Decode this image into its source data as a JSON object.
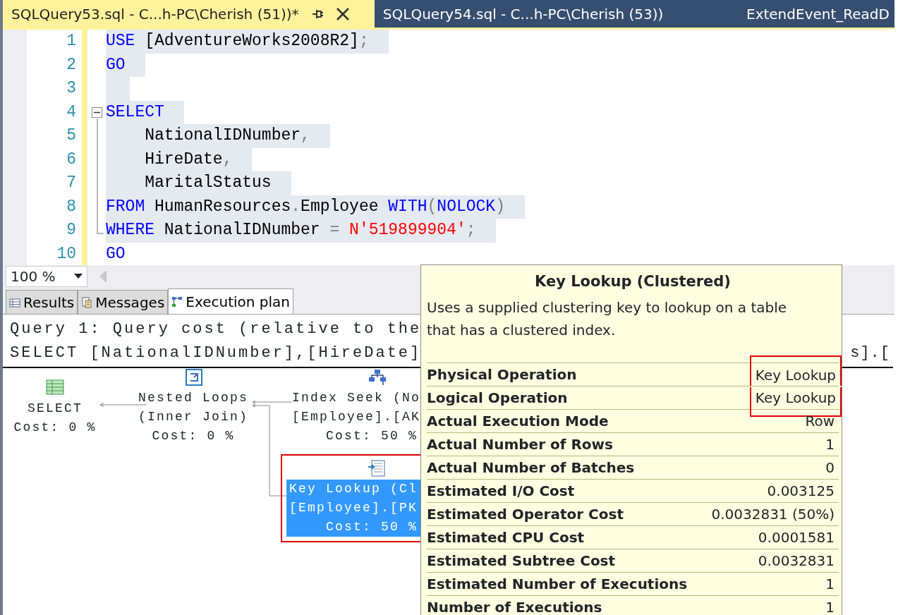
{
  "tabs": [
    {
      "title": "SQLQuery53.sql - C...h-PC\\Cherish (51))*",
      "selected": true
    },
    {
      "title": "SQLQuery54.sql - C...h-PC\\Cherish (53))",
      "selected": false
    },
    {
      "title": "ExtendEvent_ReadD",
      "selected": false
    }
  ],
  "editor": {
    "lines": [
      {
        "number": "1",
        "selected": true,
        "tokens": [
          {
            "kind": "keyword",
            "text": "USE"
          },
          {
            "kind": "plain",
            "text": " [AdventureWorks2008R2]"
          },
          {
            "kind": "punct",
            "text": ";"
          }
        ]
      },
      {
        "number": "2",
        "selected": true,
        "tokens": [
          {
            "kind": "keyword",
            "text": "GO"
          }
        ]
      },
      {
        "number": "3",
        "selected": true
      },
      {
        "number": "4",
        "selected": true,
        "expanded": true,
        "tokens": [
          {
            "kind": "keyword",
            "text": "SELECT"
          }
        ],
        "children": [
          {
            "number": "5",
            "selected": true,
            "tokens": [
              {
                "kind": "plain",
                "text": "    NationalIDNumber"
              },
              {
                "kind": "punct",
                "text": ","
              }
            ]
          },
          {
            "number": "6",
            "selected": true,
            "tokens": [
              {
                "kind": "plain",
                "text": "    HireDate"
              },
              {
                "kind": "punct",
                "text": ","
              }
            ]
          },
          {
            "number": "7",
            "selected": true,
            "tokens": [
              {
                "kind": "plain",
                "text": "    MaritalStatus"
              }
            ]
          },
          {
            "number": "8",
            "selected": true,
            "tokens": [
              {
                "kind": "keyword",
                "text": "FROM"
              },
              {
                "kind": "plain",
                "text": " HumanResources"
              },
              {
                "kind": "punct",
                "text": "."
              },
              {
                "kind": "plain",
                "text": "Employee "
              },
              {
                "kind": "keyword",
                "text": "WITH"
              },
              {
                "kind": "punct",
                "text": "("
              },
              {
                "kind": "keyword",
                "text": "NOLOCK"
              },
              {
                "kind": "punct",
                "text": ")"
              }
            ]
          },
          {
            "number": "9",
            "selected": true,
            "tokens": [
              {
                "kind": "keyword",
                "text": "WHERE"
              },
              {
                "kind": "plain",
                "text": " NationalIDNumber "
              },
              {
                "kind": "punct",
                "text": "= "
              },
              {
                "kind": "string",
                "text": "N'519899904'"
              },
              {
                "kind": "punct",
                "text": ";"
              }
            ]
          }
        ]
      },
      {
        "number": "10",
        "selected": false,
        "tokens": [
          {
            "kind": "keyword",
            "text": "GO"
          }
        ]
      }
    ]
  },
  "zoom": {
    "value": "100 %"
  },
  "result_tabs": [
    {
      "label": "Results",
      "kind": "grid",
      "selected": false
    },
    {
      "label": "Messages",
      "kind": "messages",
      "selected": false
    },
    {
      "label": "Execution plan",
      "kind": "plan",
      "selected": true
    }
  ],
  "plan": {
    "header_lines": [
      {
        "text": "Query 1: Query cost (relative to the"
      },
      {
        "text": "SELECT [NationalIDNumber],[HireDate]",
        "continuation": "s].["
      }
    ],
    "nodes": [
      {
        "kind": "select",
        "lines": [
          "SELECT",
          "Cost: 0 %"
        ],
        "selected": false,
        "highlighted": false
      },
      {
        "kind": "nested_loops",
        "lines": [
          "Nested Loops",
          "(Inner Join)",
          "Cost: 0 %"
        ],
        "selected": false,
        "highlighted": false
      },
      {
        "kind": "index_seek",
        "lines": [
          "Index Seek (No",
          "[Employee].[AK",
          "Cost: 50 %"
        ],
        "selected": false,
        "highlighted": false
      },
      {
        "kind": "key_lookup",
        "lines": [
          "Key Lookup (Cl",
          "[Employee].[PK",
          "Cost: 50 %"
        ],
        "selected": true,
        "highlighted": true
      }
    ]
  },
  "tooltip": {
    "title": "Key Lookup (Clustered)",
    "description": "Uses a supplied clustering key to lookup on a table that has a clustered index.",
    "properties": [
      {
        "name": "Physical Operation",
        "value": "Key Lookup",
        "highlighted": true
      },
      {
        "name": "Logical Operation",
        "value": "Key Lookup",
        "highlighted": true
      },
      {
        "name": "Actual Execution Mode",
        "value": "Row",
        "highlighted": false
      },
      {
        "name": "Actual Number of Rows",
        "value": "1",
        "highlighted": false
      },
      {
        "name": "Actual Number of Batches",
        "value": "0",
        "highlighted": false
      },
      {
        "name": "Estimated I/O Cost",
        "value": "0.003125",
        "highlighted": false
      },
      {
        "name": "Estimated Operator Cost",
        "value": "0.0032831 (50%)",
        "highlighted": false
      },
      {
        "name": "Estimated CPU Cost",
        "value": "0.0001581",
        "highlighted": false
      },
      {
        "name": "Estimated Subtree Cost",
        "value": "0.0032831",
        "highlighted": false
      },
      {
        "name": "Estimated Number of Executions",
        "value": "1",
        "highlighted": false
      },
      {
        "name": "Number of Executions",
        "value": "1",
        "highlighted": false
      }
    ]
  }
}
